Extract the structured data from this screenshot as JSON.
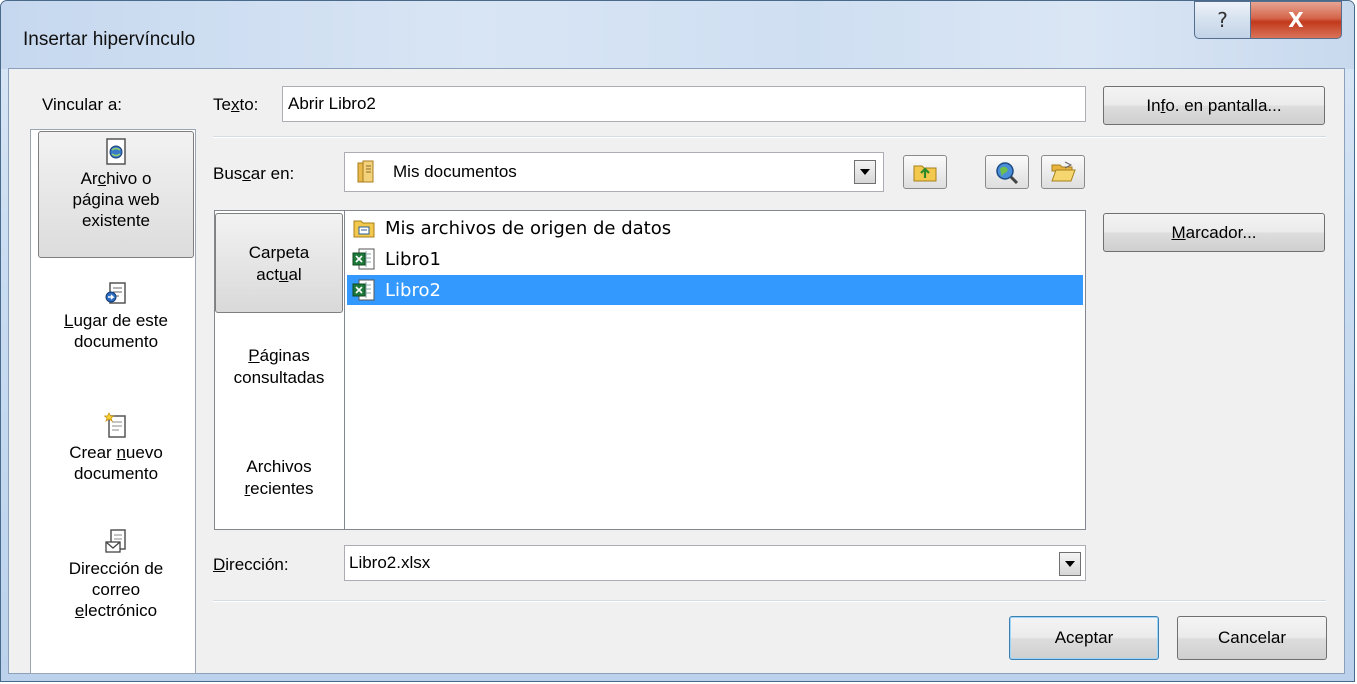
{
  "window": {
    "title": "Insertar hipervínculo",
    "help_glyph": "?",
    "close_glyph": "X"
  },
  "nav": {
    "label": "Vincular a:",
    "items": [
      {
        "l1a": "Ar",
        "l1u": "c",
        "l1b": "hivo o",
        "l2": "página web",
        "l3": "existente"
      },
      {
        "l1u": "L",
        "l1b": "ugar de este",
        "l2": "documento"
      },
      {
        "l1a": "Crear ",
        "l1u": "n",
        "l1b": "uevo",
        "l2": "documento"
      },
      {
        "l1": "Dirección de",
        "l2": "correo",
        "l3u": "e",
        "l3b": "lectrónico"
      }
    ]
  },
  "text_field": {
    "label_a": "Te",
    "label_u": "x",
    "label_b": "to:",
    "value": "Abrir Libro2"
  },
  "screen_tip_button": {
    "a": "In",
    "u": "f",
    "b": "o. en pantalla..."
  },
  "look_in": {
    "label_a": "Bus",
    "label_u": "c",
    "label_b": "ar en:",
    "value": "Mis documentos"
  },
  "scope_tabs": [
    {
      "l1": "Carpeta",
      "l2a": "act",
      "l2u": "u",
      "l2b": "al"
    },
    {
      "l1u": "P",
      "l1b": "áginas",
      "l2": "consultadas"
    },
    {
      "l1": "Archivos",
      "l2u": "r",
      "l2b": "ecientes"
    }
  ],
  "files": [
    {
      "name": "Mis archivos de origen de datos",
      "icon": "data-source-folder-icon",
      "selected": false
    },
    {
      "name": "Libro1",
      "icon": "excel-file-icon",
      "selected": false
    },
    {
      "name": "Libro2",
      "icon": "excel-file-icon",
      "selected": true
    }
  ],
  "bookmark_button": {
    "u": "M",
    "b": "arcador..."
  },
  "address": {
    "label_u": "D",
    "label_b": "irección:",
    "value": "Libro2.xlsx"
  },
  "ok_button": "Aceptar",
  "cancel_button": "Cancelar",
  "colors": {
    "selection": "#3399ff",
    "title_bg": "#cfdff2",
    "close_red": "#c2391c"
  }
}
